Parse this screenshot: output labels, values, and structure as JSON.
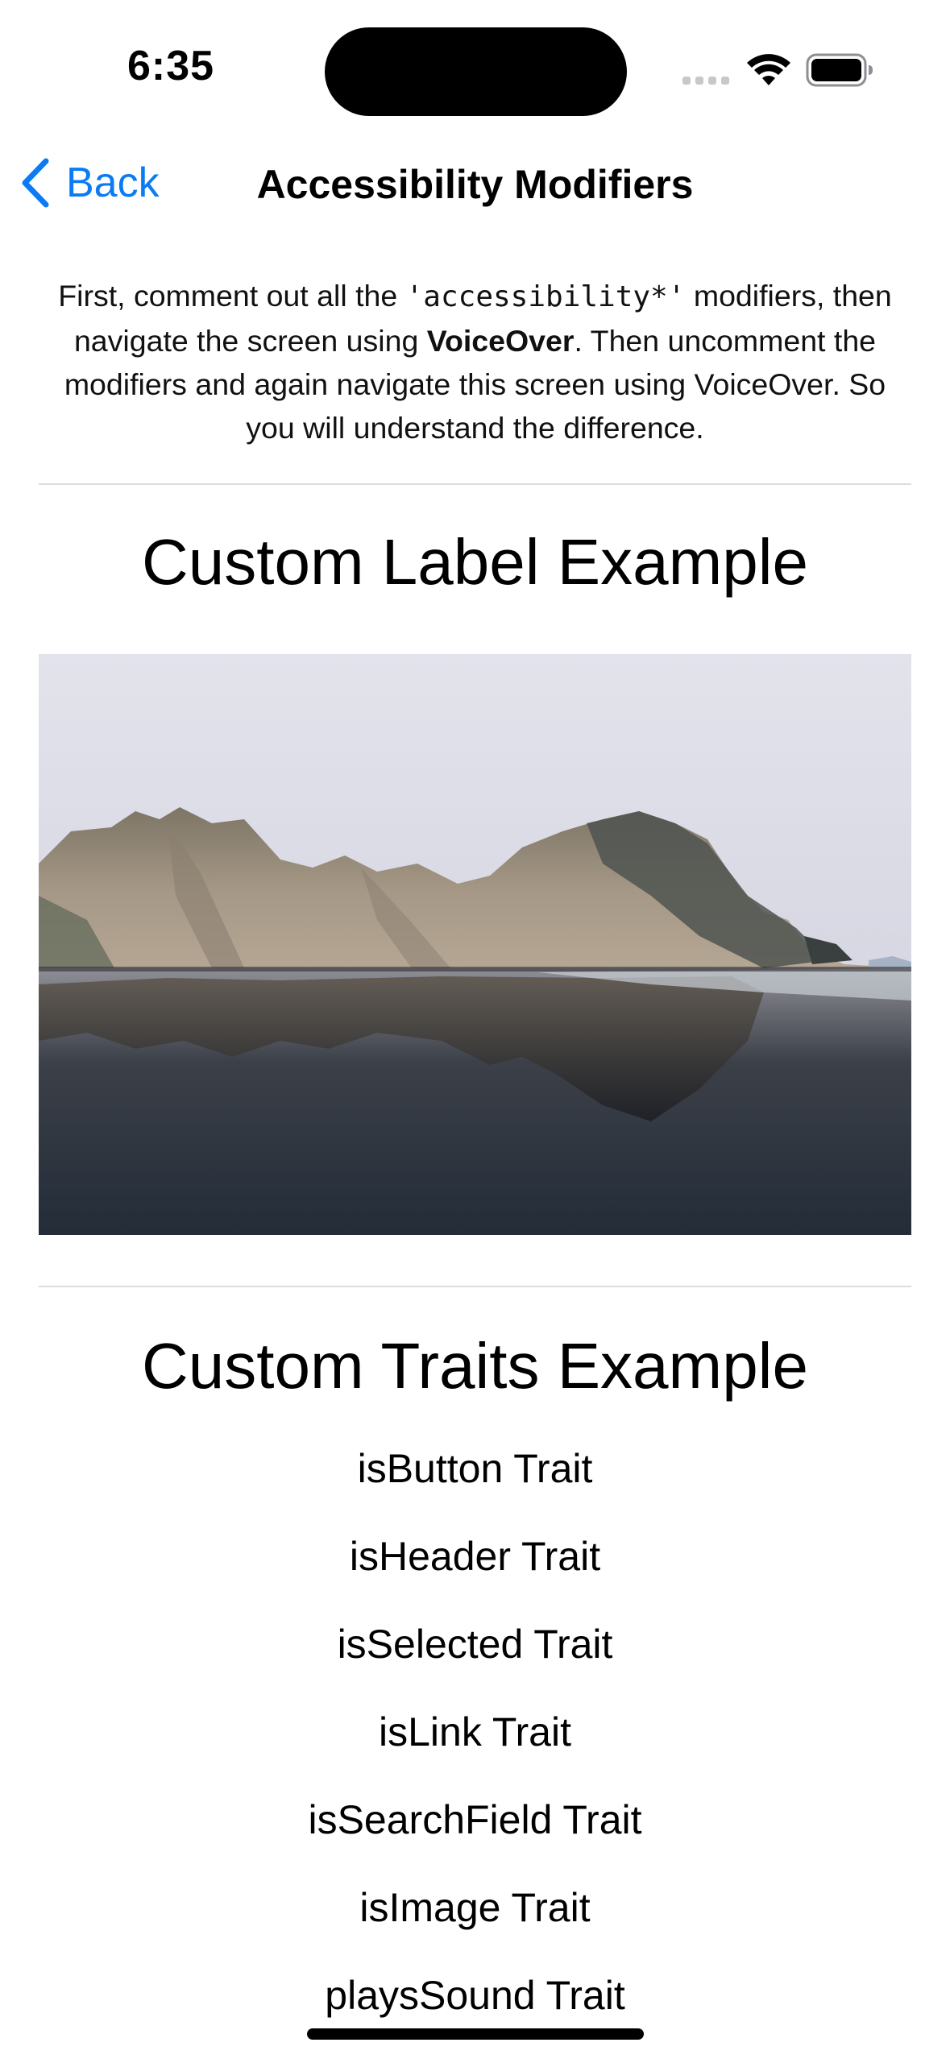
{
  "status_bar": {
    "time": "6:35"
  },
  "nav": {
    "back_label": "Back",
    "title": "Accessibility Modifiers",
    "accent_color": "#0a84ff"
  },
  "intro": {
    "part1": "First, comment out all the ",
    "code": "'accessibility*'",
    "part2": " modifiers, then navigate the screen using ",
    "bold": "VoiceOver",
    "part3": ". Then uncomment the modifiers and again navigate this screen using VoiceOver. So you will understand the difference."
  },
  "label_section": {
    "title": "Custom Label Example"
  },
  "traits_section": {
    "title": "Custom Traits Example",
    "items": [
      "isButton Trait",
      "isHeader Trait",
      "isSelected Trait",
      "isLink Trait",
      "isSearchField Trait",
      "isImage Trait",
      "playsSound Trait"
    ]
  }
}
